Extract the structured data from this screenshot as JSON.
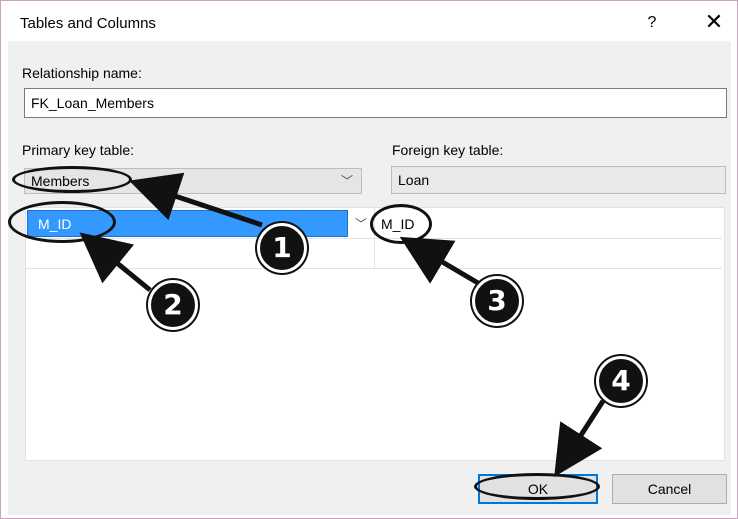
{
  "dialog": {
    "title": "Tables and Columns",
    "help_label": "?",
    "close_label": "✕"
  },
  "relationship": {
    "label": "Relationship name:",
    "value": "FK_Loan_Members"
  },
  "primary_key": {
    "label": "Primary key table:",
    "value": "Members",
    "column_value": "M_ID"
  },
  "foreign_key": {
    "label": "Foreign key table:",
    "value": "Loan",
    "column_value": "M_ID"
  },
  "buttons": {
    "ok_label": "OK",
    "cancel_label": "Cancel"
  },
  "annotations": {
    "callouts": [
      "1",
      "2",
      "3",
      "4"
    ]
  },
  "icons": {
    "dropdown": "chevron-down-icon",
    "help": "help-icon",
    "close": "close-icon"
  },
  "colors": {
    "selection": "#3399ff",
    "default_button_border": "#0078d7",
    "annotation": "#111111"
  }
}
